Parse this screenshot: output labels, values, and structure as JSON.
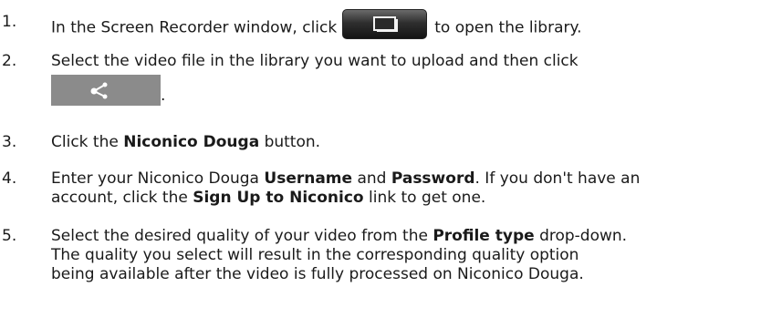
{
  "steps": [
    {
      "number": "1.",
      "before": "In the Screen Recorder window, click",
      "after": "to open the library.",
      "button_icon": "library-stack-icon"
    },
    {
      "number": "2.",
      "line1": "Select the video file in the library you want to upload and then click",
      "after": ".",
      "button_icon": "share-icon"
    },
    {
      "number": "3.",
      "before": "Click the",
      "bold1": "Niconico Douga",
      "after": "button."
    },
    {
      "number": "4.",
      "t1": "Enter your Niconico Douga",
      "b1": "Username",
      "t2": "and",
      "b2": "Password",
      "t3": ". If you don't have an",
      "t4": "account, click the",
      "b3": "Sign Up to Niconico",
      "t5": "link to get one."
    },
    {
      "number": "5.",
      "t1": "Select the desired quality of your video from the",
      "b1": "Profile type",
      "t2": "drop-down.",
      "line2": "The quality you select will result in the corresponding quality option",
      "line3": "being available after the video is fully processed on Niconico Douga."
    }
  ]
}
